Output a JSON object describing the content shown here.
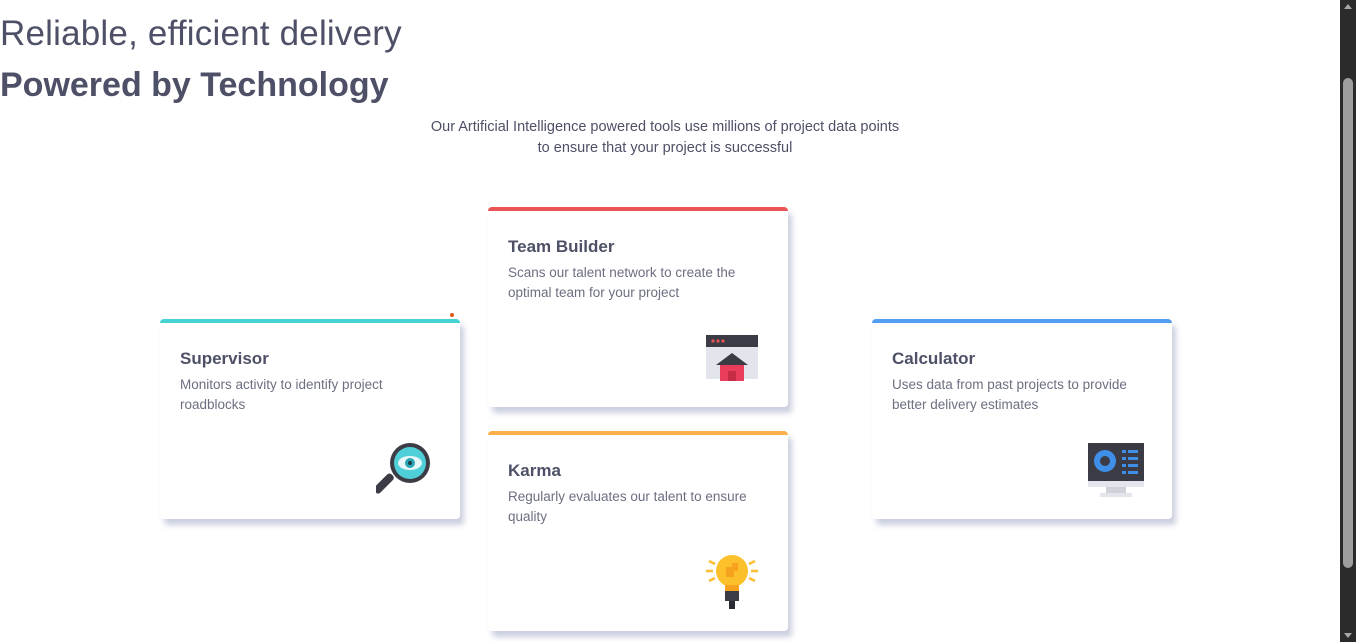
{
  "header": {
    "subtitle": "Reliable, efficient delivery",
    "title": "Powered by Technology",
    "description_line1": "Our Artificial Intelligence powered tools use millions of project data points",
    "description_line2": "to ensure that your project is successful"
  },
  "cards": {
    "supervisor": {
      "title": "Supervisor",
      "text": "Monitors activity to identify project roadblocks",
      "accent": "#44d3d2",
      "icon": "magnifier-icon"
    },
    "team_builder": {
      "title": "Team Builder",
      "text": "Scans our talent network to create the optimal team for your project",
      "accent": "#ea5454",
      "icon": "team-builder-icon"
    },
    "karma": {
      "title": "Karma",
      "text": "Regularly evaluates our talent to ensure quality",
      "accent": "#fcaf4a",
      "icon": "lightbulb-icon"
    },
    "calculator": {
      "title": "Calculator",
      "text": "Uses data from past projects to provide better delivery estimates",
      "accent": "#549ef2",
      "icon": "calculator-monitor-icon"
    }
  },
  "colors": {
    "heading": "#4d5066",
    "body_text": "#6c6f80",
    "background": "#ffffff"
  }
}
